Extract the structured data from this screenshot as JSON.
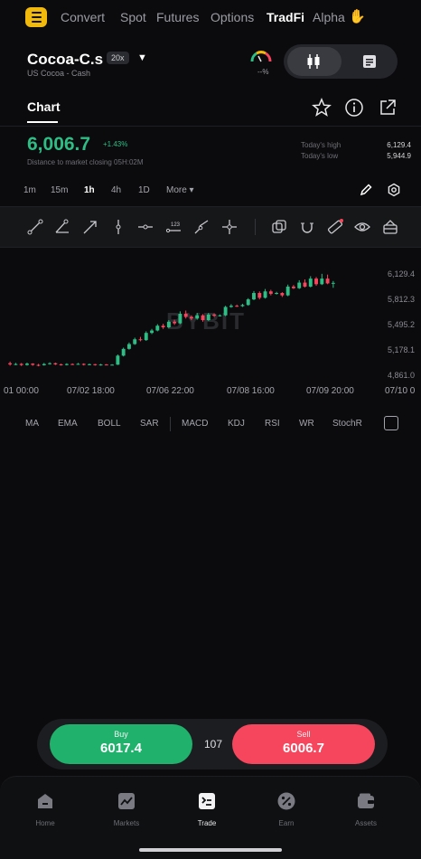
{
  "nav": {
    "tabs": [
      "Convert",
      "Spot",
      "Futures",
      "Options",
      "TradFi",
      "Alpha"
    ],
    "active_tab": "TradFi"
  },
  "symbol": {
    "name": "Cocoa-C.s",
    "leverage": "20x",
    "dropdown_icon": "▼",
    "subtitle": "US Cocoa - Cash",
    "gauge_value": "--%"
  },
  "tabs": {
    "chart": "Chart"
  },
  "price": {
    "last": "6,006.7",
    "change": "+1.43%",
    "closing_note": "Distance to market closing 05H:02M",
    "high_label": "Today's high",
    "high_value": "6,129.4",
    "low_label": "Today's low",
    "low_value": "5,944.9"
  },
  "intervals": [
    "1m",
    "15m",
    "1h",
    "4h",
    "1D"
  ],
  "active_interval": "1h",
  "more_label": "More ▾",
  "chart": {
    "watermark": "BYBIT",
    "y_labels": [
      "6,129.4",
      "5,812.3",
      "5,495.2",
      "5,178.1",
      "4,861.0"
    ],
    "x_labels": [
      "01 00:00",
      "07/02 18:00",
      "07/06 22:00",
      "07/08 16:00",
      "07/09 20:00",
      "07/10 0"
    ]
  },
  "chart_data": {
    "type": "candlestick",
    "title": "",
    "xlabel": "",
    "ylabel": "",
    "ylim": [
      4861.0,
      6129.4
    ],
    "x_ticks": [
      "01 00:00",
      "07/02 18:00",
      "07/06 22:00",
      "07/08 16:00",
      "07/09 20:00",
      "07/10 0"
    ],
    "y_ticks": [
      6129.4,
      5812.3,
      5495.2,
      5178.1,
      4861.0
    ],
    "candles": [
      {
        "o": 5000,
        "c": 4985,
        "h": 5020,
        "l": 4970
      },
      {
        "o": 4985,
        "c": 4990,
        "h": 5005,
        "l": 4975
      },
      {
        "o": 4992,
        "c": 4978,
        "h": 5003,
        "l": 4965
      },
      {
        "o": 4978,
        "c": 4995,
        "h": 5008,
        "l": 4970
      },
      {
        "o": 4995,
        "c": 4980,
        "h": 5000,
        "l": 4968
      },
      {
        "o": 4980,
        "c": 4975,
        "h": 4992,
        "l": 4962
      },
      {
        "o": 4975,
        "c": 4990,
        "h": 5004,
        "l": 4970
      },
      {
        "o": 4990,
        "c": 5000,
        "h": 5012,
        "l": 4982
      },
      {
        "o": 5000,
        "c": 4986,
        "h": 5008,
        "l": 4978
      },
      {
        "o": 4986,
        "c": 4978,
        "h": 4995,
        "l": 4970
      },
      {
        "o": 4978,
        "c": 4990,
        "h": 5000,
        "l": 4972
      },
      {
        "o": 4990,
        "c": 4985,
        "h": 4998,
        "l": 4978
      },
      {
        "o": 4985,
        "c": 4992,
        "h": 5004,
        "l": 4980
      },
      {
        "o": 4992,
        "c": 4980,
        "h": 4999,
        "l": 4972
      },
      {
        "o": 4980,
        "c": 4988,
        "h": 4996,
        "l": 4974
      },
      {
        "o": 4988,
        "c": 4976,
        "h": 4992,
        "l": 4970
      },
      {
        "o": 4976,
        "c": 4984,
        "h": 4992,
        "l": 4970
      },
      {
        "o": 4984,
        "c": 4980,
        "h": 4990,
        "l": 4974
      },
      {
        "o": 4980,
        "c": 4982,
        "h": 4988,
        "l": 4975
      },
      {
        "o": 4982,
        "c": 5095,
        "h": 5110,
        "l": 4978
      },
      {
        "o": 5095,
        "c": 5180,
        "h": 5195,
        "l": 5085
      },
      {
        "o": 5180,
        "c": 5240,
        "h": 5260,
        "l": 5170
      },
      {
        "o": 5240,
        "c": 5300,
        "h": 5320,
        "l": 5230
      },
      {
        "o": 5300,
        "c": 5290,
        "h": 5330,
        "l": 5275
      },
      {
        "o": 5290,
        "c": 5380,
        "h": 5400,
        "l": 5280
      },
      {
        "o": 5380,
        "c": 5410,
        "h": 5430,
        "l": 5365
      },
      {
        "o": 5410,
        "c": 5470,
        "h": 5490,
        "l": 5400
      },
      {
        "o": 5470,
        "c": 5450,
        "h": 5495,
        "l": 5430
      },
      {
        "o": 5450,
        "c": 5520,
        "h": 5540,
        "l": 5440
      },
      {
        "o": 5520,
        "c": 5500,
        "h": 5545,
        "l": 5480
      },
      {
        "o": 5500,
        "c": 5620,
        "h": 5650,
        "l": 5490
      },
      {
        "o": 5620,
        "c": 5580,
        "h": 5660,
        "l": 5560
      },
      {
        "o": 5580,
        "c": 5560,
        "h": 5600,
        "l": 5540
      },
      {
        "o": 5560,
        "c": 5600,
        "h": 5630,
        "l": 5545
      },
      {
        "o": 5600,
        "c": 5540,
        "h": 5615,
        "l": 5520
      },
      {
        "o": 5540,
        "c": 5610,
        "h": 5630,
        "l": 5530
      },
      {
        "o": 5610,
        "c": 5595,
        "h": 5625,
        "l": 5580
      },
      {
        "o": 5595,
        "c": 5600,
        "h": 5612,
        "l": 5585
      },
      {
        "o": 5600,
        "c": 5705,
        "h": 5720,
        "l": 5590
      },
      {
        "o": 5705,
        "c": 5720,
        "h": 5740,
        "l": 5695
      },
      {
        "o": 5720,
        "c": 5715,
        "h": 5735,
        "l": 5705
      },
      {
        "o": 5715,
        "c": 5730,
        "h": 5745,
        "l": 5705
      },
      {
        "o": 5730,
        "c": 5800,
        "h": 5815,
        "l": 5720
      },
      {
        "o": 5800,
        "c": 5880,
        "h": 5905,
        "l": 5790
      },
      {
        "o": 5880,
        "c": 5820,
        "h": 5900,
        "l": 5800
      },
      {
        "o": 5820,
        "c": 5900,
        "h": 5930,
        "l": 5810
      },
      {
        "o": 5900,
        "c": 5870,
        "h": 5920,
        "l": 5850
      },
      {
        "o": 5870,
        "c": 5880,
        "h": 5895,
        "l": 5860
      },
      {
        "o": 5880,
        "c": 5850,
        "h": 5890,
        "l": 5830
      },
      {
        "o": 5850,
        "c": 5960,
        "h": 5985,
        "l": 5840
      },
      {
        "o": 5960,
        "c": 5940,
        "h": 5980,
        "l": 5930
      },
      {
        "o": 5940,
        "c": 6010,
        "h": 6040,
        "l": 5930
      },
      {
        "o": 6010,
        "c": 5960,
        "h": 6050,
        "l": 5950
      },
      {
        "o": 5960,
        "c": 6060,
        "h": 6090,
        "l": 5950
      },
      {
        "o": 6060,
        "c": 5990,
        "h": 6080,
        "l": 5970
      },
      {
        "o": 5990,
        "c": 6060,
        "h": 6120,
        "l": 5980
      },
      {
        "o": 6060,
        "c": 6000,
        "h": 6110,
        "l": 5990
      },
      {
        "o": 6000,
        "c": 6006.7,
        "h": 6030,
        "l": 5944.9
      }
    ]
  },
  "indicators": [
    "MA",
    "EMA",
    "BOLL",
    "SAR",
    "MACD",
    "KDJ",
    "RSI",
    "WR",
    "StochR"
  ],
  "trade": {
    "buy_label": "Buy",
    "buy_price": "6017.4",
    "sell_label": "Sell",
    "sell_price": "6006.7",
    "quantity": "107"
  },
  "bottom_nav": [
    {
      "label": "Home",
      "icon": "home-icon"
    },
    {
      "label": "Markets",
      "icon": "markets-icon"
    },
    {
      "label": "Trade",
      "icon": "trade-icon"
    },
    {
      "label": "Earn",
      "icon": "earn-icon"
    },
    {
      "label": "Assets",
      "icon": "assets-icon"
    }
  ],
  "active_bottom_tab": "Trade",
  "colors": {
    "up": "#2ebd85",
    "down": "#f6465d",
    "accent": "#f0b90b",
    "buy": "#20b26c",
    "sell": "#f6465d",
    "background": "#0b0b0d"
  }
}
